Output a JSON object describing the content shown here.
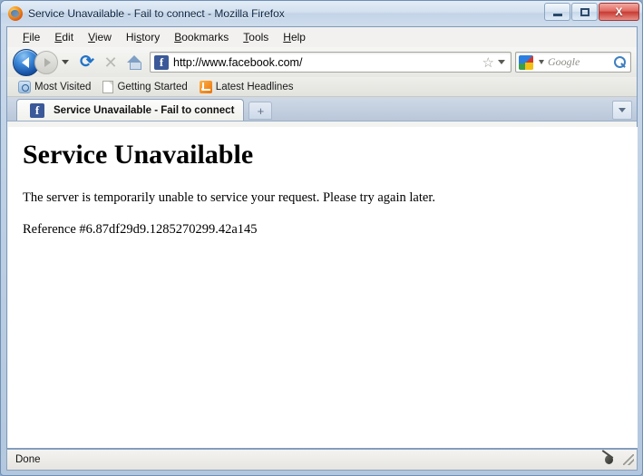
{
  "window": {
    "title": "Service Unavailable - Fail to connect - Mozilla Firefox",
    "app_icon": "firefox-icon",
    "minimize_label": "",
    "maximize_label": "",
    "close_label": "X"
  },
  "menubar": {
    "items": [
      {
        "label": "File",
        "accesskey": "F"
      },
      {
        "label": "Edit",
        "accesskey": "E"
      },
      {
        "label": "View",
        "accesskey": "V"
      },
      {
        "label": "History",
        "accesskey": "s"
      },
      {
        "label": "Bookmarks",
        "accesskey": "B"
      },
      {
        "label": "Tools",
        "accesskey": "T"
      },
      {
        "label": "Help",
        "accesskey": "H"
      }
    ]
  },
  "toolbar": {
    "back_icon": "back-arrow-icon",
    "forward_icon": "forward-arrow-icon",
    "history_dropdown_icon": "chevron-down-icon",
    "reload_icon": "reload-icon",
    "reload_glyph": "⟳",
    "stop_icon": "stop-icon",
    "stop_glyph": "✕",
    "home_icon": "home-icon",
    "url": "http://www.facebook.com/",
    "url_placeholder": "",
    "site_favicon": "facebook-favicon",
    "favicon_letter": "f",
    "bookmark_star_glyph": "☆",
    "search_placeholder": "Google",
    "search_value": "",
    "search_engine_icon": "google-icon",
    "search_submit_icon": "magnifier-icon"
  },
  "bookmarks_toolbar": {
    "items": [
      {
        "label": "Most Visited",
        "icon": "most-visited-icon"
      },
      {
        "label": "Getting Started",
        "icon": "page-icon"
      },
      {
        "label": "Latest Headlines",
        "icon": "rss-icon"
      }
    ]
  },
  "tabs": {
    "active": {
      "title": "Service Unavailable - Fail to connect",
      "favicon": "facebook-favicon",
      "favicon_letter": "f"
    },
    "new_tab_glyph": "+",
    "list_all_tabs_icon": "chevron-down-icon"
  },
  "page": {
    "heading": "Service Unavailable",
    "body": "The server is temporarily unable to service your request. Please try again later.",
    "reference": "Reference #6.87df29d9.1285270299.42a145"
  },
  "statusbar": {
    "text": "Done",
    "bug_icon": "bug-icon",
    "resize_grip": "resize-grip-icon"
  },
  "colors": {
    "facebook_blue": "#3b5998",
    "firefox_orange": "#e8730c",
    "close_red": "#c73b33",
    "accent_blue": "#1f73c8"
  }
}
